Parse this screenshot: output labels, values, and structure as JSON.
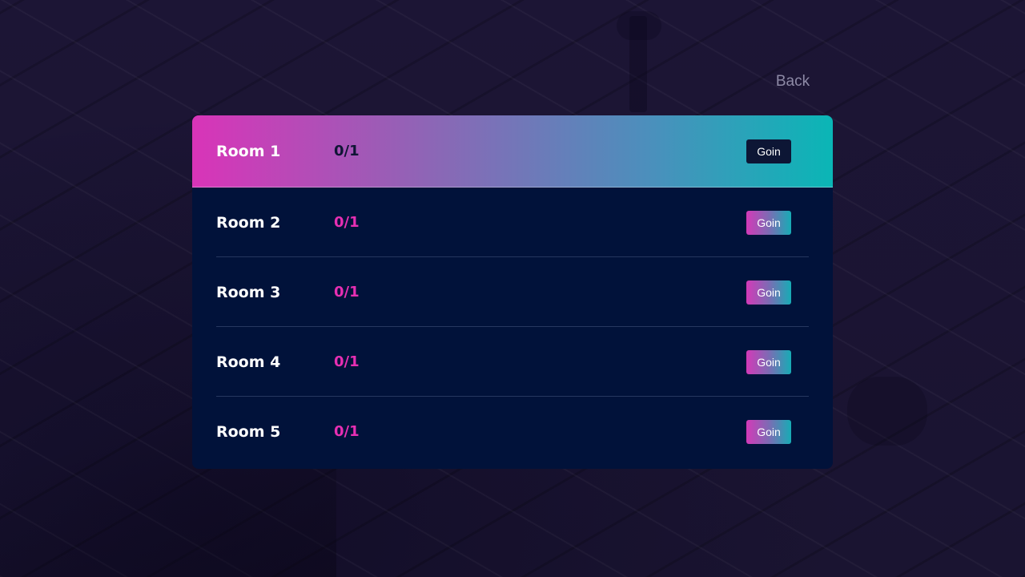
{
  "header": {
    "back_label": "Back"
  },
  "rooms": [
    {
      "name": "Room 1",
      "players": "0/1",
      "join_label": "Goin",
      "selected": true
    },
    {
      "name": "Room 2",
      "players": "0/1",
      "join_label": "Goin",
      "selected": false
    },
    {
      "name": "Room 3",
      "players": "0/1",
      "join_label": "Goin",
      "selected": false
    },
    {
      "name": "Room 4",
      "players": "0/1",
      "join_label": "Goin",
      "selected": false
    },
    {
      "name": "Room 5",
      "players": "0/1",
      "join_label": "Goin",
      "selected": false
    }
  ],
  "colors": {
    "background": "#1a1433",
    "panel": "#01123a",
    "accent_pink": "#e72fb3",
    "accent_teal": "#0ab6b6",
    "back_text": "#8e8aa6"
  }
}
